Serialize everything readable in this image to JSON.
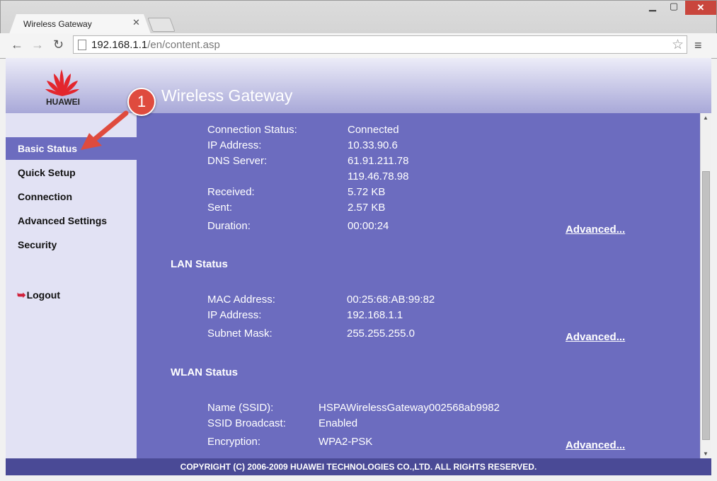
{
  "browser": {
    "tab_title": "Wireless Gateway",
    "url_host": "192.168.1.1",
    "url_path": "/en/content.asp"
  },
  "header": {
    "brand": "HUAWEI",
    "title": "Wireless Gateway"
  },
  "sidebar": {
    "items": [
      {
        "label": "Basic Status"
      },
      {
        "label": "Quick Setup"
      },
      {
        "label": "Connection"
      },
      {
        "label": "Advanced Settings"
      },
      {
        "label": "Security"
      }
    ],
    "logout": "Logout"
  },
  "wan": {
    "connection_status_label": "Connection Status:",
    "connection_status_value": "Connected",
    "ip_label": "IP Address:",
    "ip_value": "10.33.90.6",
    "dns_label": "DNS Server:",
    "dns_value_1": "61.91.211.78",
    "dns_value_2": "119.46.78.98",
    "received_label": "Received:",
    "received_value": "5.72 KB",
    "sent_label": "Sent:",
    "sent_value": "2.57 KB",
    "duration_label": "Duration:",
    "duration_value": "00:00:24",
    "advanced": "Advanced..."
  },
  "lan": {
    "title": "LAN Status",
    "mac_label": "MAC Address:",
    "mac_value": "00:25:68:AB:99:82",
    "ip_label": "IP Address:",
    "ip_value": "192.168.1.1",
    "subnet_label": "Subnet Mask:",
    "subnet_value": "255.255.255.0",
    "advanced": "Advanced..."
  },
  "wlan": {
    "title": "WLAN Status",
    "ssid_label": "Name (SSID):",
    "ssid_value": "HSPAWirelessGateway002568ab9982",
    "broadcast_label": "SSID Broadcast:",
    "broadcast_value": "Enabled",
    "encryption_label": "Encryption:",
    "encryption_value": "WPA2-PSK",
    "advanced": "Advanced..."
  },
  "footer": "COPYRIGHT (C) 2006-2009 HUAWEI TECHNOLOGIES CO.,LTD. ALL RIGHTS RESERVED.",
  "annotation": {
    "step_number": "1"
  },
  "colors": {
    "content_bg": "#6c6cbf",
    "footer_bg": "#4a4a96",
    "sidebar_bg": "#e2e2f4",
    "accent_red": "#df4b3e"
  }
}
